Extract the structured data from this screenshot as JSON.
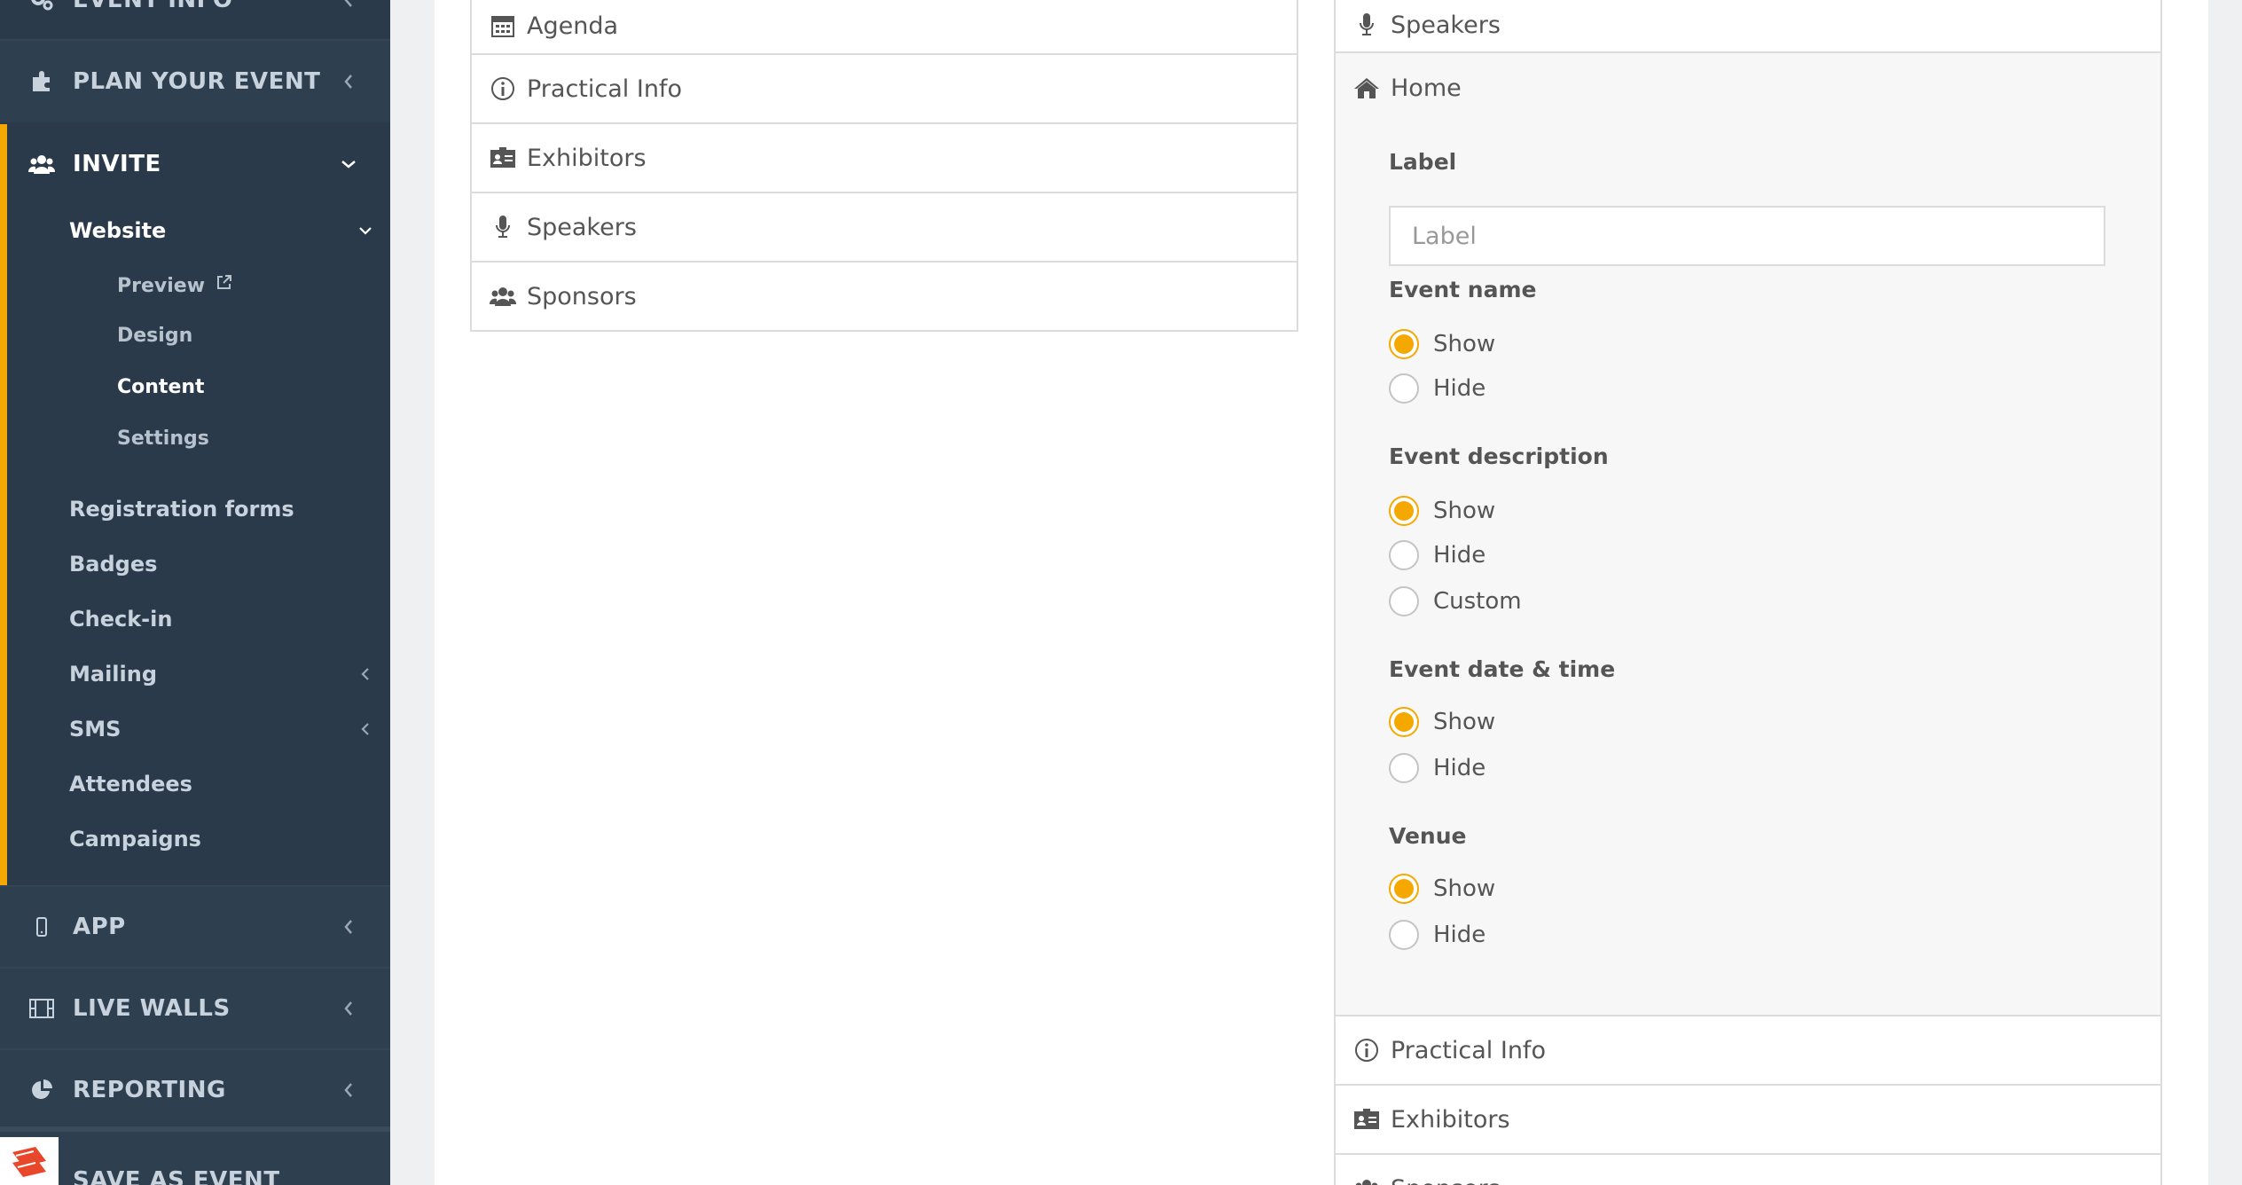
{
  "sidebar": {
    "sections": {
      "event_info": "EVENT INFO",
      "plan": "PLAN YOUR EVENT",
      "invite": "INVITE",
      "app": "APP",
      "live_walls": "LIVE WALLS",
      "reporting": "REPORTING",
      "save_as_event": "SAVE AS EVENT"
    },
    "invite_items": {
      "website": "Website",
      "preview": "Preview",
      "design": "Design",
      "content": "Content",
      "settings": "Settings",
      "registration_forms": "Registration forms",
      "badges": "Badges",
      "check_in": "Check-in",
      "mailing": "Mailing",
      "sms": "SMS",
      "attendees": "Attendees",
      "campaigns": "Campaigns"
    },
    "accent_color": "#f5a800"
  },
  "menu_list": [
    {
      "label": "Agenda",
      "icon": "calendar-icon"
    },
    {
      "label": "Practical Info",
      "icon": "info-icon"
    },
    {
      "label": "Exhibitors",
      "icon": "id-card-icon"
    },
    {
      "label": "Speakers",
      "icon": "microphone-icon"
    },
    {
      "label": "Sponsors",
      "icon": "users-icon"
    }
  ],
  "right_col": {
    "top_row": "Speakers",
    "home": {
      "title": "Home",
      "label_field": {
        "label": "Label",
        "placeholder": "Label"
      },
      "event_name": {
        "label": "Event name",
        "options": [
          "Show",
          "Hide"
        ],
        "selected": "Show"
      },
      "event_description": {
        "label": "Event description",
        "options": [
          "Show",
          "Hide",
          "Custom"
        ],
        "selected": "Show"
      },
      "event_date_time": {
        "label": "Event date & time",
        "options": [
          "Show",
          "Hide"
        ],
        "selected": "Show"
      },
      "venue": {
        "label": "Venue",
        "options": [
          "Show",
          "Hide"
        ],
        "selected": "Show"
      }
    },
    "bottom_rows": [
      "Practical Info",
      "Exhibitors",
      "Sponsors"
    ]
  }
}
